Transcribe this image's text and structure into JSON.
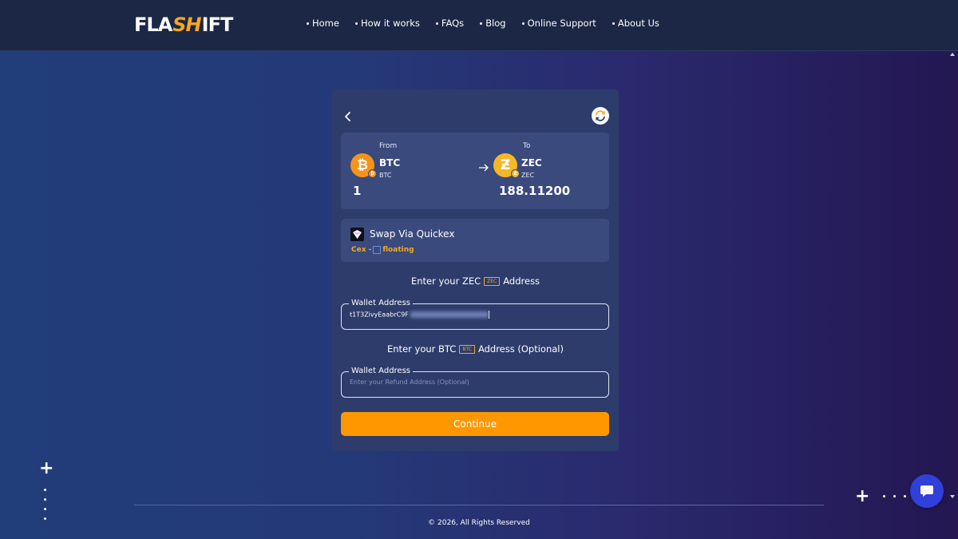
{
  "header": {
    "logo_left": "FLA",
    "logo_mid": "SH",
    "logo_right": "IFT",
    "nav": [
      "Home",
      "How it works",
      "FAQs",
      "Blog",
      "Online Support",
      "About Us"
    ]
  },
  "swap": {
    "from_label": "From",
    "to_label": "To",
    "from": {
      "symbol": "BTC",
      "network": "BTC",
      "amount": "1",
      "icon": "bitcoin-icon",
      "color": "#f7931a"
    },
    "to": {
      "symbol": "ZEC",
      "network": "ZEC",
      "amount": "188.11200",
      "icon": "zcash-icon",
      "color": "#f4b728"
    }
  },
  "provider": {
    "title": "Swap Via Quickex",
    "tag_cex": "Cex -",
    "tag_type": "floating"
  },
  "recipient": {
    "title_prefix": "Enter your ZEC",
    "chip": "ZEC",
    "title_suffix": "Address",
    "legend": "Wallet Address",
    "value": "t1T3ZivyEaabrC9F"
  },
  "refund": {
    "title_prefix": "Enter your BTC",
    "chip": "BTC",
    "title_suffix": "Address (Optional)",
    "legend": "Wallet Address",
    "placeholder": "Enter your Refund Address (Optional)"
  },
  "continue_label": "Continue",
  "footer": {
    "copyright": "© 2026, All Rights Reserved"
  },
  "colors": {
    "accent": "#ff9800",
    "card": "#2d3c6b",
    "panel": "#3a4a7c",
    "chat": "#3040d8"
  }
}
